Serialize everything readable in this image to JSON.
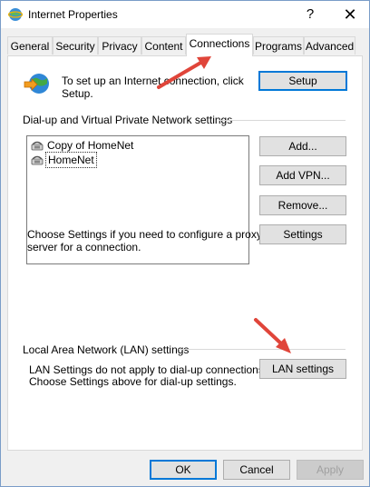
{
  "window": {
    "title": "Internet Properties",
    "help": "?",
    "close": "✕"
  },
  "tabs": [
    {
      "label": "General"
    },
    {
      "label": "Security"
    },
    {
      "label": "Privacy"
    },
    {
      "label": "Content"
    },
    {
      "label": "Connections"
    },
    {
      "label": "Programs"
    },
    {
      "label": "Advanced"
    }
  ],
  "active_tab": "Connections",
  "setup": {
    "text_line1": "To set up an Internet connection, click",
    "text_line2": "Setup.",
    "button": "Setup"
  },
  "dialup": {
    "group_label": "Dial-up and Virtual Private Network settings",
    "items": [
      {
        "label": "Copy of HomeNet",
        "selected": false
      },
      {
        "label": "HomeNet",
        "selected": true
      }
    ],
    "add": "Add...",
    "add_vpn": "Add VPN...",
    "remove": "Remove...",
    "proxy_text_line1": "Choose Settings if you need to configure a proxy",
    "proxy_text_line2": "server for a connection.",
    "settings": "Settings"
  },
  "lan": {
    "group_label": "Local Area Network (LAN) settings",
    "text_line1": "LAN Settings do not apply to dial-up connections.",
    "text_line2": "Choose Settings above for dial-up settings.",
    "button": "LAN settings"
  },
  "footer": {
    "ok": "OK",
    "cancel": "Cancel",
    "apply": "Apply"
  },
  "colors": {
    "accent": "#0078d7",
    "arrow": "#e0453a"
  }
}
